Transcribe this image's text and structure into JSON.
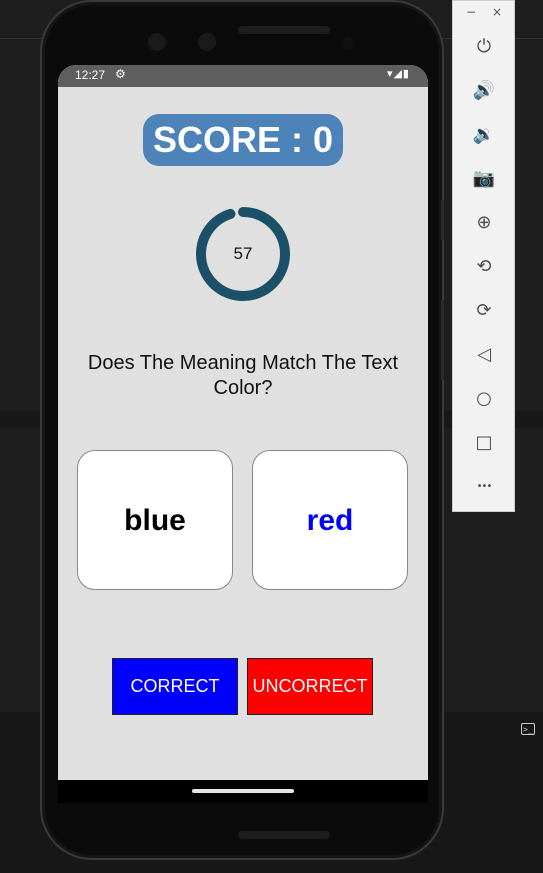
{
  "statusbar": {
    "time": "12:27",
    "indicators": "▾◢▮"
  },
  "app": {
    "score_text": "SCORE : 0",
    "timer": {
      "value": "57",
      "fraction": 0.95
    },
    "question": "Does The Meaning Match The Text Color?",
    "cards": [
      {
        "word": "blue",
        "color": "#000000"
      },
      {
        "word": "red",
        "color": "#0000ff"
      }
    ],
    "buttons": {
      "correct_label": "CORRECT",
      "uncorrect_label": "UNCORRECT"
    },
    "colors": {
      "score_bg": "#4d83b8",
      "timer_ring": "#1b5068",
      "correct_bg": "#0000ff",
      "uncorrect_bg": "#ff0000"
    }
  },
  "emulator_toolbar": {
    "window_controls": {
      "minimize": "−",
      "close": "×"
    },
    "items": [
      {
        "name": "power-icon",
        "glyph": "⏻"
      },
      {
        "name": "volume-up-icon",
        "glyph": "🔊"
      },
      {
        "name": "volume-down-icon",
        "glyph": "🔉"
      },
      {
        "name": "camera-icon",
        "glyph": "📷"
      },
      {
        "name": "zoom-icon",
        "glyph": "⊕"
      },
      {
        "name": "rotate-left-icon",
        "glyph": "⟲"
      },
      {
        "name": "rotate-right-icon",
        "glyph": "⟳"
      },
      {
        "name": "back-icon",
        "glyph": "◁"
      },
      {
        "name": "home-icon",
        "glyph": "○"
      },
      {
        "name": "overview-icon",
        "glyph": "□"
      },
      {
        "name": "more-icon",
        "glyph": "•••"
      }
    ]
  }
}
